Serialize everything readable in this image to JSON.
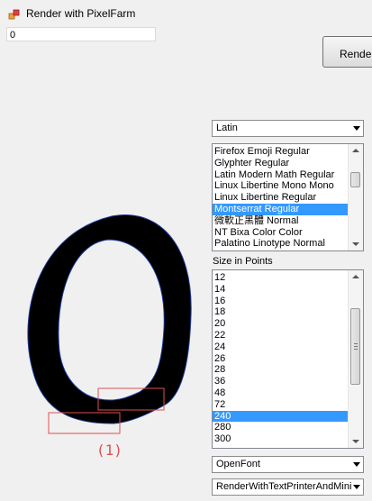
{
  "window": {
    "title": "Render with PixelFarm"
  },
  "text_input": {
    "value": "0"
  },
  "render_button": {
    "label": "Render"
  },
  "script_combo": {
    "selected": "Latin"
  },
  "font_list": {
    "items": [
      "Firefox Emoji Regular",
      "Glyphter Regular",
      "Latin Modern Math Regular",
      "Linux Libertine Mono Mono",
      "Linux Libertine Regular",
      "Montserrat Regular",
      "微軟正黑體 Normal",
      "NT Bixa Color Color",
      "Palatino Linotype Normal"
    ],
    "selected_index": 5
  },
  "size_label": "Size in Points",
  "size_list": {
    "items": [
      "12",
      "14",
      "16",
      "18",
      "20",
      "22",
      "24",
      "26",
      "28",
      "36",
      "48",
      "72",
      "240",
      "280",
      "300"
    ],
    "selected_index": 12
  },
  "font_source_combo": {
    "selected": "OpenFont"
  },
  "renderer_combo": {
    "selected": "RenderWithTextPrinterAndMini"
  },
  "annotation": {
    "text": "(1)"
  },
  "colors": {
    "selection": "#3399ff",
    "annotation": "#e05050",
    "glyph": "#000000"
  }
}
